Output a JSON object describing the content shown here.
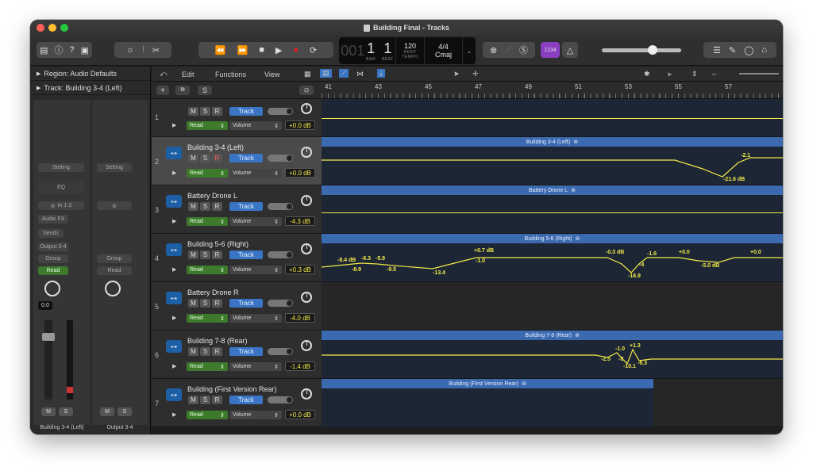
{
  "window": {
    "title": "Building Final - Tracks"
  },
  "lcd": {
    "bar": "1",
    "beat": "1",
    "bar_label": "BAR",
    "beat_label": "BEAT",
    "tempo": "120",
    "keep": "KEEP",
    "tempo_label": "TEMPO",
    "signature": "4/4",
    "key": "Cmaj",
    "prefix": "001"
  },
  "toolbar": {
    "count_in": "1234"
  },
  "inspector": {
    "region": "Region: Audio Defaults",
    "track": "Track: Building 3-4 (Left)",
    "setting": "Setting",
    "eq": "EQ",
    "input": "In 1-2",
    "audio_fx": "Audio FX",
    "sends": "Sends",
    "output": "Output 3-4",
    "group": "Group",
    "read": "Read",
    "gain": "0.0",
    "mute": "M",
    "solo": "S",
    "strip1_name": "Building 3-4 (Left)",
    "strip2_name": "Output 3-4"
  },
  "menus": {
    "edit": "Edit",
    "functions": "Functions",
    "view": "View"
  },
  "header": {
    "add": "+",
    "solo": "S"
  },
  "ruler": [
    "41",
    "43",
    "45",
    "47",
    "49",
    "51",
    "53",
    "55",
    "57"
  ],
  "tracks": [
    {
      "num": "1",
      "name": "",
      "mode": "Read",
      "param": "Volume",
      "db": "+0.0 dB",
      "record_armed": false
    },
    {
      "num": "2",
      "name": "Building 3-4 (Left)",
      "mode": "Read",
      "param": "Volume",
      "db": "+0.0 dB",
      "record_armed": true
    },
    {
      "num": "3",
      "name": "Battery Drone L",
      "mode": "Read",
      "param": "Volume",
      "db": "-4.3 dB",
      "record_armed": false
    },
    {
      "num": "4",
      "name": "Building 5-6 (Right)",
      "mode": "Read",
      "param": "Volume",
      "db": "+0.3 dB",
      "record_armed": false
    },
    {
      "num": "5",
      "name": "Battery Drone R",
      "mode": "Read",
      "param": "Volume",
      "db": "-4.0 dB",
      "record_armed": false
    },
    {
      "num": "6",
      "name": "Building 7-8 (Rear)",
      "mode": "Read",
      "param": "Volume",
      "db": "-1.4 dB",
      "record_armed": false
    },
    {
      "num": "7",
      "name": "Building (First Version Rear)",
      "mode": "Read",
      "param": "Volume",
      "db": "+0.0 dB",
      "record_armed": false
    }
  ],
  "buttons": {
    "m": "M",
    "s": "S",
    "r": "R",
    "track": "Track"
  },
  "regions": [
    "Building 3-4 (Left)",
    "Battery Drone L",
    "Building 5-6 (Right)",
    "Building 7-8 (Rear)",
    "Building (First Version Rear)"
  ],
  "auto_labels": {
    "t2": [
      "-2.1",
      "-21.6 dB"
    ],
    "t4": [
      "-8.4 dB",
      "-6.3",
      "-5.9",
      "-8.9",
      "-9.5",
      "-13.4",
      "+0.7 dB",
      "-1.0",
      "-0.3 dB",
      "-1.6",
      "-4",
      "-16.9",
      "+0.0",
      "-5.0 dB",
      "+0.0"
    ],
    "t6": [
      "-1.0",
      "+1.3",
      "-2.5",
      "-8",
      "-10.1",
      "-6.3"
    ]
  },
  "colors": {
    "accent": "#3b6ab0",
    "automation": "#f2e94a",
    "read": "#3d7a2b",
    "record": "#e02020"
  }
}
